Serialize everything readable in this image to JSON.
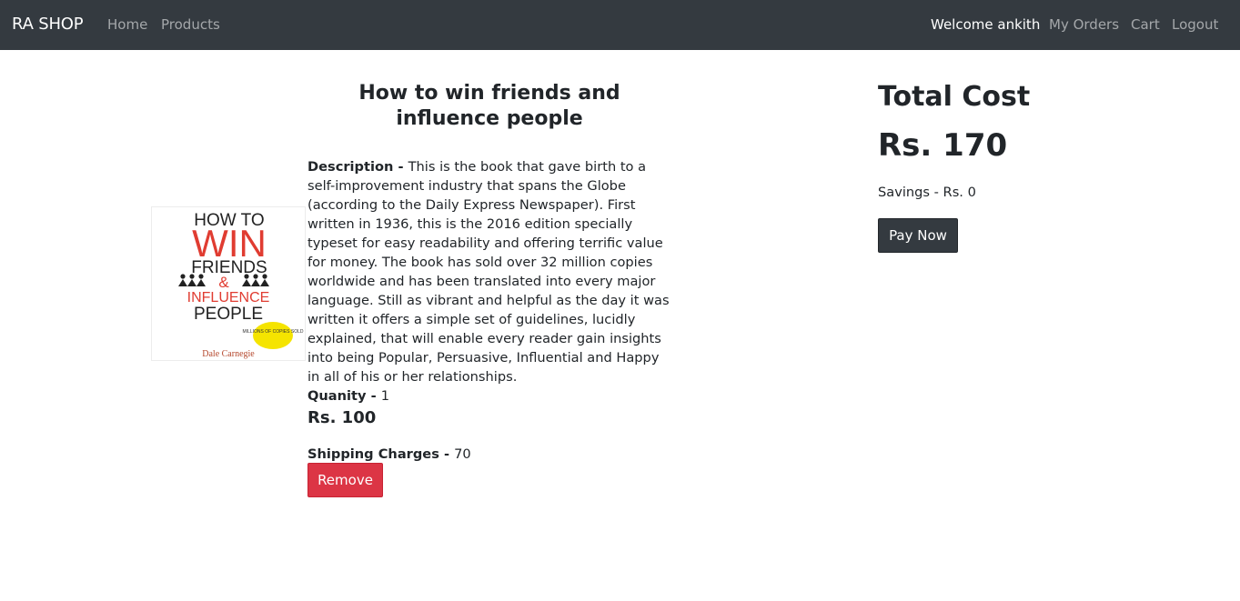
{
  "navbar": {
    "brand": "RA SHOP",
    "left_links": [
      "Home",
      "Products"
    ],
    "welcome": "Welcome ankith",
    "right_links": [
      "My Orders",
      "Cart",
      "Logout"
    ]
  },
  "cart_item": {
    "title": "How to win friends and influence people",
    "cover": {
      "line1": "HOW TO",
      "line2": "WIN",
      "line3": "FRIENDS",
      "line4": "&",
      "line5": "INFLUENCE",
      "line6": "PEOPLE",
      "badge": "MILLIONS OF COPIES SOLD",
      "author": "Dale Carnegie"
    },
    "description_label": "Description - ",
    "description": "This is the book that gave birth to a self-improvement industry that spans the Globe (according to the Daily Express Newspaper). First written in 1936, this is the 2016 edition specially typeset for easy readability and offering terrific value for money. The book has sold over 32 million copies worldwide and has been translated into every major language. Still as vibrant and helpful as the day it was written it offers a simple set of guidelines, lucidly explained, that will enable every reader gain insights into being Popular, Persuasive, Influential and Happy in all of his or her relationships.",
    "quantity_label": "Quanity - ",
    "quantity": "1",
    "price": "Rs. 100",
    "shipping_label": "Shipping Charges - ",
    "shipping": "70",
    "remove_label": "Remove"
  },
  "summary": {
    "heading": "Total Cost",
    "total": "Rs. 170",
    "savings": "Savings - Rs. 0",
    "pay_label": "Pay Now"
  },
  "colors": {
    "navbar_bg": "#343a40",
    "remove_btn": "#dc3545",
    "pay_btn": "#343a40",
    "cover_red": "#e03c31",
    "badge_yellow": "#f5e400"
  }
}
